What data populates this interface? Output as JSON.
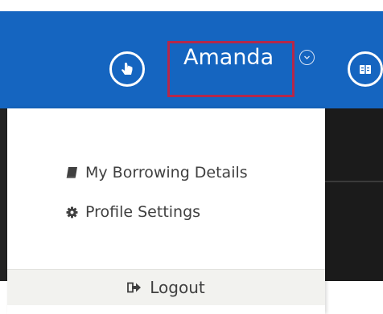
{
  "header": {
    "user_name": "Amanda",
    "icons": {
      "left_button": "hand-pointer-icon",
      "dropdown": "chevron-down-circle-icon",
      "right_button": "book-reader-icon"
    },
    "colors": {
      "bar": "#1565c0",
      "highlight_border": "#b5284a"
    }
  },
  "user_menu": {
    "items": [
      {
        "label": "My Borrowing Details",
        "icon": "book-icon"
      },
      {
        "label": "Profile Settings",
        "icon": "gear-icon"
      }
    ],
    "logout": {
      "label": "Logout",
      "icon": "sign-out-icon"
    }
  }
}
